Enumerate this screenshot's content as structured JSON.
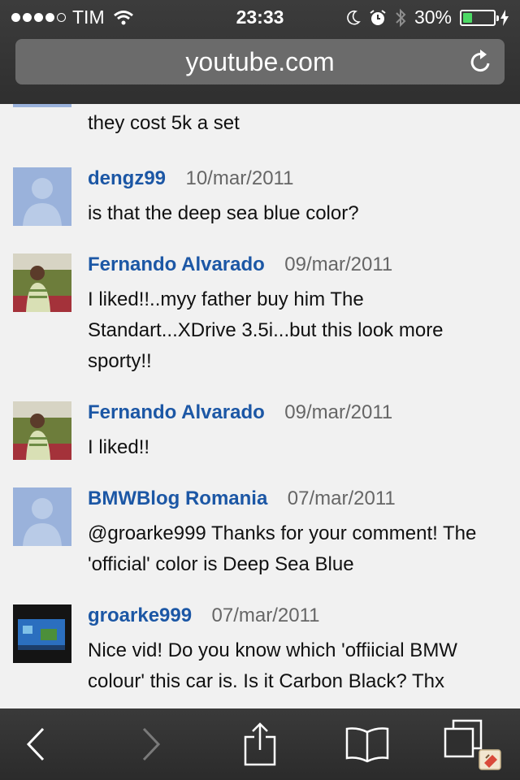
{
  "status_bar": {
    "carrier": "TIM",
    "time": "23:33",
    "battery_percent": "30%",
    "battery_level": 0.3,
    "icons": [
      "signal-dots",
      "wifi-icon",
      "moon-icon",
      "alarm-icon",
      "bluetooth-icon",
      "battery-icon",
      "charging-icon"
    ]
  },
  "address_bar": {
    "url": "youtube.com",
    "reload_icon": "reload-icon"
  },
  "colors": {
    "author": "#1c57a5",
    "battery_fill": "#4cd964",
    "default_avatar": "#9ab2db"
  },
  "partial_comment": {
    "text": "they cost 5k a set"
  },
  "comments": [
    {
      "author": "dengz99",
      "date": "10/mar/2011",
      "text": "is that the deep sea blue color?",
      "avatar": "default-avatar"
    },
    {
      "author": "Fernando Alvarado",
      "date": "09/mar/2011",
      "text": "I liked!!..myy father buy him The Standart...XDrive 3.5i...but this look more sporty!!",
      "avatar": "photo-avatar"
    },
    {
      "author": "Fernando Alvarado",
      "date": "09/mar/2011",
      "text": "I liked!!",
      "avatar": "photo-avatar"
    },
    {
      "author": "BMWBlog Romania",
      "date": "07/mar/2011",
      "text": "@groarke999 Thanks for your comment! The 'official' color is Deep Sea Blue",
      "avatar": "default-avatar"
    },
    {
      "author": "groarke999",
      "date": "07/mar/2011",
      "text": "Nice vid! Do you know which 'offiicial BMW colour' this car is. Is it Carbon Black? Thx",
      "avatar": "screen-avatar"
    }
  ],
  "toolbar": {
    "items": [
      "back-icon",
      "forward-icon",
      "share-icon",
      "bookmarks-icon",
      "tabs-icon"
    ]
  }
}
